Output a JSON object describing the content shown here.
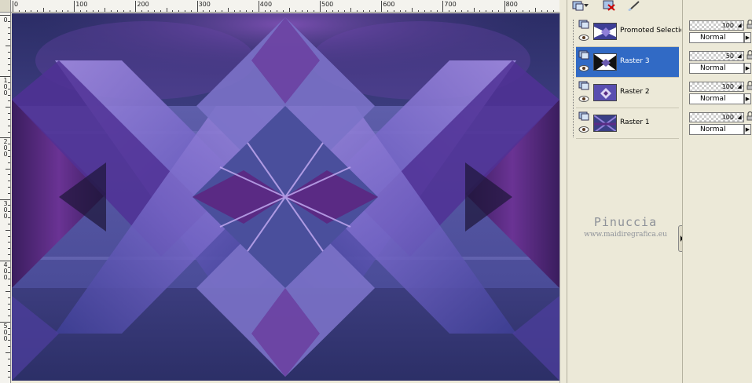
{
  "ruler": {
    "h_labels": [
      "0",
      "100",
      "200",
      "300",
      "400",
      "500",
      "600",
      "700",
      "800"
    ],
    "v_labels": [
      {
        "text": "1\n0\n0"
      },
      {
        "text": "2\n0\n0"
      },
      {
        "text": "3\n0\n0"
      },
      {
        "text": "4\n0\n0"
      },
      {
        "text": "5\n0\n0"
      }
    ]
  },
  "toolbar": {
    "icons": [
      "layer-palette-icon",
      "delete-layer-icon",
      "edit-brush-icon"
    ]
  },
  "layers": [
    {
      "name": "Promoted Selection",
      "selected": false,
      "thumb": "promoted"
    },
    {
      "name": "Raster 3",
      "selected": true,
      "thumb": "raster3"
    },
    {
      "name": "Raster 2",
      "selected": false,
      "thumb": "raster2"
    },
    {
      "name": "Raster 1",
      "selected": false,
      "thumb": "raster1"
    }
  ],
  "properties": [
    {
      "opacity": "100",
      "blend": "Normal"
    },
    {
      "opacity": "50",
      "blend": "Normal"
    },
    {
      "opacity": "100",
      "blend": "Normal"
    },
    {
      "opacity": "100",
      "blend": "Normal"
    }
  ],
  "watermark": {
    "name": "Pinuccia",
    "url": "www.maidiregrafica.eu"
  },
  "colors": {
    "canvas_dark": "#2e3168",
    "canvas_mid": "#5b5aa6",
    "canvas_light": "#8f7fd8",
    "purple": "#5a2c85",
    "selection": "#316ac5"
  }
}
